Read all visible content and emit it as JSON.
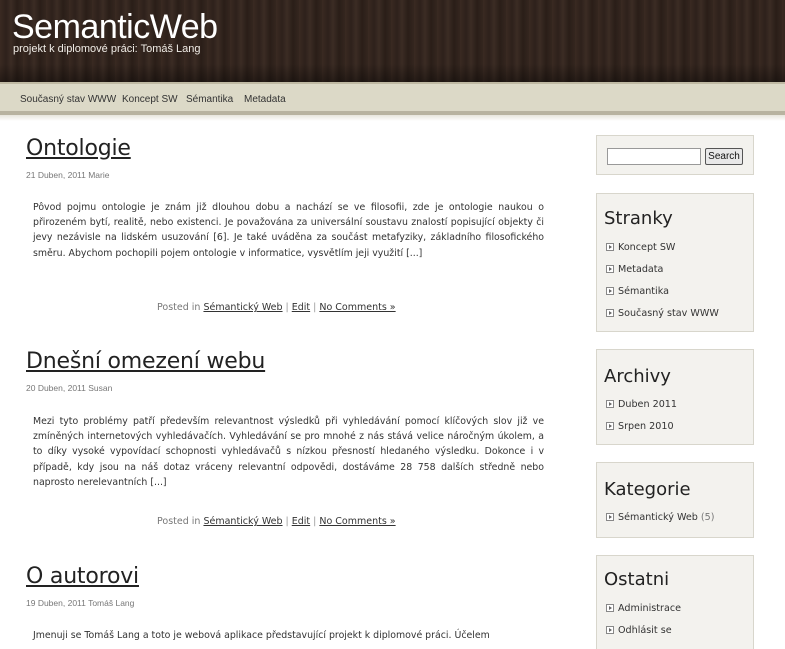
{
  "site": {
    "title": "SemanticWeb",
    "tagline": "projekt k diplomové práci: Tomáš Lang"
  },
  "nav": {
    "items": [
      "Současný stav WWW",
      "Koncept SW",
      "Sémantika",
      "Metadata"
    ]
  },
  "posts": [
    {
      "title": "Ontologie",
      "meta": "21 Duben, 2011 Marie",
      "body": "Pôvod pojmu ontologie je znám již dlouhou dobu a nachází se ve filosofii, zde je ontologie naukou o přirozeném bytí, realitě, nebo existenci. Je považována za universální soustavu znalostí popisující objekty či jevy nezávisle na lidském usuzování [6]. Je také uváděna za součást metafyziky, základního filosofického směru. Abychom pochopili pojem ontologie v informatice, vysvětlím jeji využití [...]",
      "posted_in": "Posted in",
      "category": "Sémantický Web",
      "edit": "Edit",
      "comments": "No Comments »"
    },
    {
      "title": "Dnešní omezení webu",
      "meta": "20 Duben, 2011 Susan",
      "body": "Mezi tyto problémy patří především relevantnost výsledků při vyhledávání pomocí klíčových slov již ve zmíněných internetových vyhledávačích. Vyhledávání se pro mnohé z nás stává velice náročným úkolem, a to díky vysoké vypovídací schopnosti vyhledávačů s nízkou přesností hledaného výsledku. Dokonce i v případě, kdy jsou na náš dotaz vráceny relevantní odpovědi, dostáváme 28 758 dalších středně nebo naprosto nerelevantních [...]",
      "posted_in": "Posted in",
      "category": "Sémantický Web",
      "edit": "Edit",
      "comments": "No Comments »"
    },
    {
      "title": "O autorovi",
      "meta": "19 Duben, 2011 Tomáš Lang",
      "body": "Jmenuji se Tomáš Lang a toto je webová aplikace představující projekt k diplomové práci. Účelem"
    }
  ],
  "sidebar": {
    "search_button": "Search",
    "search_value": "",
    "stranky": {
      "title": "Stranky",
      "items": [
        "Koncept SW",
        "Metadata",
        "Sémantika",
        "Současný stav WWW"
      ]
    },
    "archivy": {
      "title": "Archivy",
      "items": [
        "Duben 2011",
        "Srpen 2010"
      ]
    },
    "kategorie": {
      "title": "Kategorie",
      "items": [
        {
          "label": "Sémantický Web",
          "count": "(5)"
        }
      ]
    },
    "ostatni": {
      "title": "Ostatni",
      "items": [
        "Administrace",
        "Odhlásit se"
      ]
    }
  }
}
